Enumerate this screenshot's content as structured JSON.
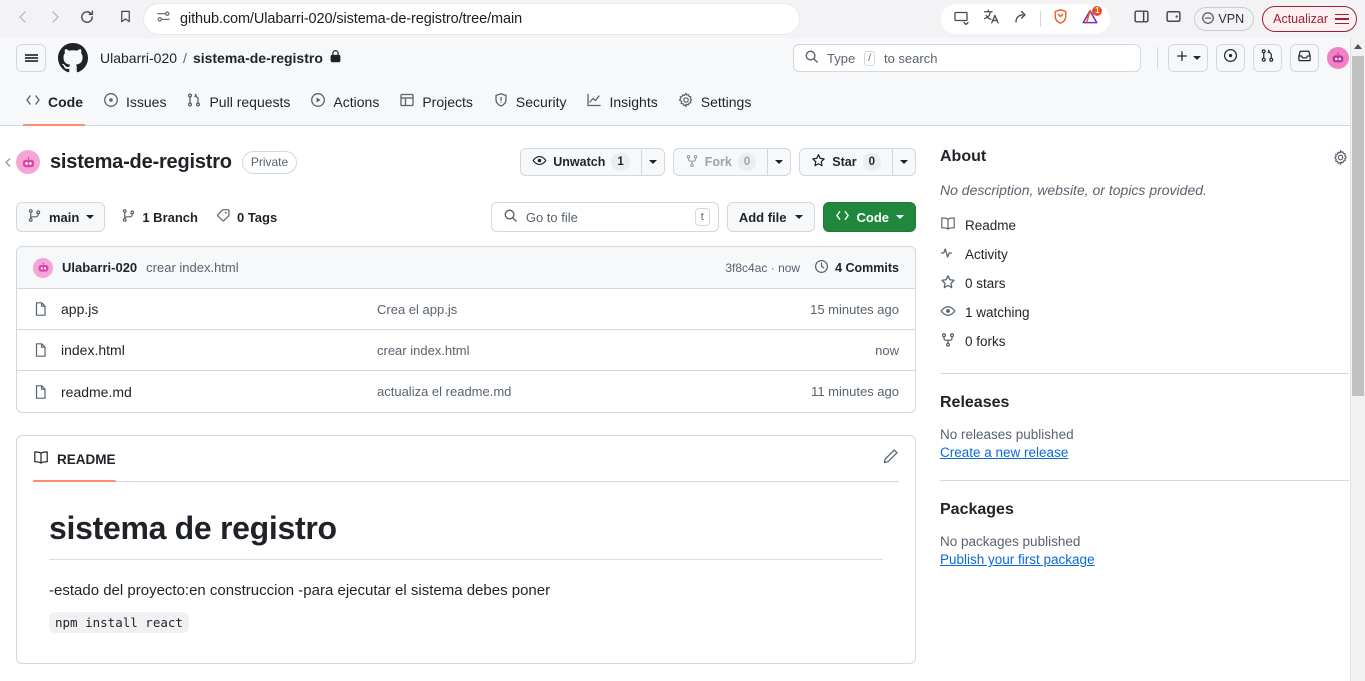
{
  "browser": {
    "back_icon": "back-arrow-icon",
    "forward_icon": "forward-arrow-icon",
    "reload_icon": "reload-icon",
    "bookmark_icon": "bookmark-icon",
    "site_settings_icon": "site-settings-icon",
    "url": "github.com/Ulabarri-020/sistema-de-registro/tree/main",
    "toolbar_icons": [
      "picture-in-picture-icon",
      "translate-icon",
      "share-icon",
      "brave-shields-icon",
      "brave-rewards-icon"
    ],
    "rewards_badge": "1",
    "sidebar_icon": "sidebar-toggle-icon",
    "wallet_icon": "brave-wallet-icon",
    "vpn_label": "VPN",
    "update_label": "Actualizar"
  },
  "gh_header": {
    "menu_icon": "hamburger-menu-icon",
    "logo_icon": "github-logo-icon",
    "owner": "Ulabarri-020",
    "separator": "/",
    "repo": "sistema-de-registro",
    "lock_icon": "lock-icon",
    "search_placeholder": "Type",
    "search_kbd": "/",
    "search_suffix": "to search",
    "create_icon": "plus-icon",
    "issues_icon": "issues-dot-icon",
    "pulls_icon": "pull-request-icon",
    "inbox_icon": "inbox-icon",
    "avatar": "user-avatar"
  },
  "repo_nav": {
    "tabs": [
      {
        "label": "Code",
        "icon": "code-icon",
        "active": true
      },
      {
        "label": "Issues",
        "icon": "issue-opened-icon",
        "active": false
      },
      {
        "label": "Pull requests",
        "icon": "git-pull-request-icon",
        "active": false
      },
      {
        "label": "Actions",
        "icon": "play-icon",
        "active": false
      },
      {
        "label": "Projects",
        "icon": "table-icon",
        "active": false
      },
      {
        "label": "Security",
        "icon": "shield-icon",
        "active": false
      },
      {
        "label": "Insights",
        "icon": "graph-icon",
        "active": false
      },
      {
        "label": "Settings",
        "icon": "gear-icon",
        "active": false
      }
    ]
  },
  "repo_header": {
    "avatar_icon": "repo-owner-avatar",
    "name": "sistema-de-registro",
    "visibility": "Private",
    "watch": {
      "icon": "eye-icon",
      "label": "Unwatch",
      "count": "1"
    },
    "fork": {
      "icon": "repo-forked-icon",
      "label": "Fork",
      "count": "0"
    },
    "star": {
      "icon": "star-icon",
      "label": "Star",
      "count": "0"
    }
  },
  "toolbar": {
    "branch_icon": "git-branch-icon",
    "branch_name": "main",
    "branches_label": "1 Branch",
    "tags_icon": "tag-icon",
    "tags_label": "0 Tags",
    "gotofile_icon": "search-icon",
    "gotofile_placeholder": "Go to file",
    "gotofile_kbd": "t",
    "addfile_label": "Add file",
    "code_icon": "code-icon",
    "code_label": "Code"
  },
  "commit_bar": {
    "avatar_icon": "commit-author-avatar",
    "author": "Ulabarri-020",
    "message": "crear index.html",
    "sha_time": "3f8c4ac · now",
    "history_icon": "history-icon",
    "commits_label": "4 Commits"
  },
  "files": {
    "rows": [
      {
        "icon": "file-icon",
        "name": "app.js",
        "message": "Crea el app.js",
        "time": "15 minutes ago"
      },
      {
        "icon": "file-icon",
        "name": "index.html",
        "message": "crear index.html",
        "time": "now"
      },
      {
        "icon": "file-icon",
        "name": "readme.md",
        "message": "actualiza el readme.md",
        "time": "11 minutes ago"
      }
    ]
  },
  "readme": {
    "tab_icon": "book-icon",
    "tab_label": "README",
    "edit_icon": "pencil-icon",
    "heading": "sistema de registro",
    "paragraph": "-estado del proyecto:en construccion -para ejecutar el sistema debes poner",
    "code": "npm install react"
  },
  "about": {
    "title": "About",
    "gear_icon": "gear-icon",
    "description": "No description, website, or topics provided.",
    "items": [
      {
        "icon": "book-icon",
        "label": "Readme"
      },
      {
        "icon": "pulse-icon",
        "label": "Activity"
      },
      {
        "icon": "star-icon",
        "label": "0 stars"
      },
      {
        "icon": "eye-icon",
        "label": "1 watching"
      },
      {
        "icon": "repo-forked-icon",
        "label": "0 forks"
      }
    ]
  },
  "releases": {
    "title": "Releases",
    "empty": "No releases published",
    "link": "Create a new release"
  },
  "packages": {
    "title": "Packages",
    "empty": "No packages published",
    "link": "Publish your first package"
  },
  "colors": {
    "accent_green": "#1f883d",
    "accent_blue": "#0969da",
    "tab_underline": "#fd8c73",
    "header_bg": "#f6f8fa",
    "border": "#d1d9e0",
    "avatar_pink": "#f6a6d6",
    "update_red": "#9d2235"
  }
}
